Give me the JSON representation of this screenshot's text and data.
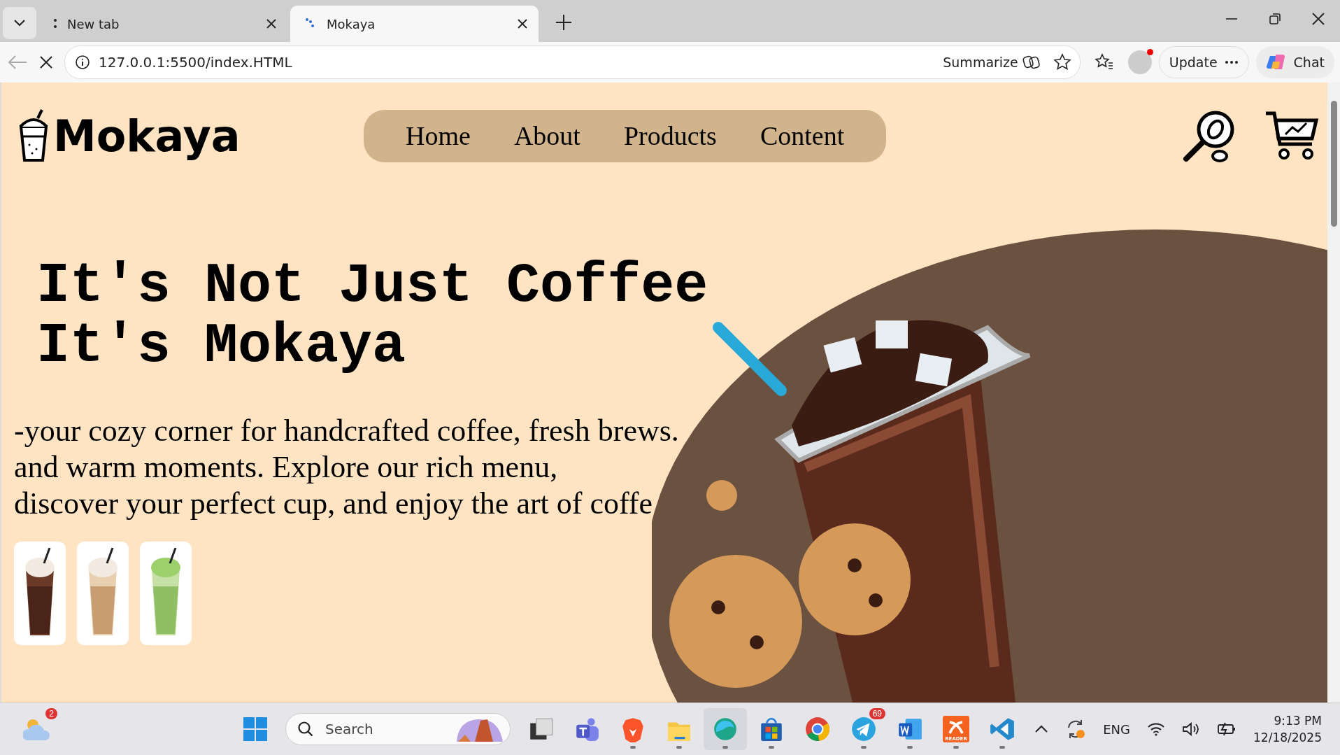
{
  "browser": {
    "tabs": [
      {
        "title": "New tab",
        "selected": false
      },
      {
        "title": "Mokaya",
        "selected": true
      }
    ],
    "address": "127.0.0.1:5500/index.HTML",
    "summarize": "Summarize",
    "update": "Update",
    "chat": "Chat"
  },
  "site": {
    "logo": "Mokaya",
    "nav": [
      "Home",
      "About",
      "Products",
      "Content"
    ],
    "headline": [
      "It's Not Just Coffee",
      "It's Mokaya"
    ],
    "intro": [
      "-your cozy corner for handcrafted coffee, fresh brews.",
      "and warm moments. Explore our rich menu,",
      "discover your perfect cup, and enjoy the art of coffe"
    ],
    "thumbnails": [
      {
        "kind": "chocolate"
      },
      {
        "kind": "caramel"
      },
      {
        "kind": "matcha"
      }
    ]
  },
  "taskbar": {
    "weather_badge": "2",
    "search_placeholder": "Search",
    "apps": [
      {
        "kind": "taskview",
        "running": false
      },
      {
        "kind": "teams",
        "running": false
      },
      {
        "kind": "brave",
        "running": true
      },
      {
        "kind": "folder",
        "running": true
      },
      {
        "kind": "edge",
        "running": true
      },
      {
        "kind": "store",
        "running": true
      },
      {
        "kind": "chrome",
        "running": false
      },
      {
        "kind": "telegram",
        "running": true,
        "badge": "69"
      },
      {
        "kind": "word",
        "running": true
      },
      {
        "kind": "reader",
        "running": true,
        "label": "READER"
      },
      {
        "kind": "vscode",
        "running": true
      }
    ],
    "language": "ENG",
    "time": "9:13 PM",
    "date": "12/18/2025"
  }
}
